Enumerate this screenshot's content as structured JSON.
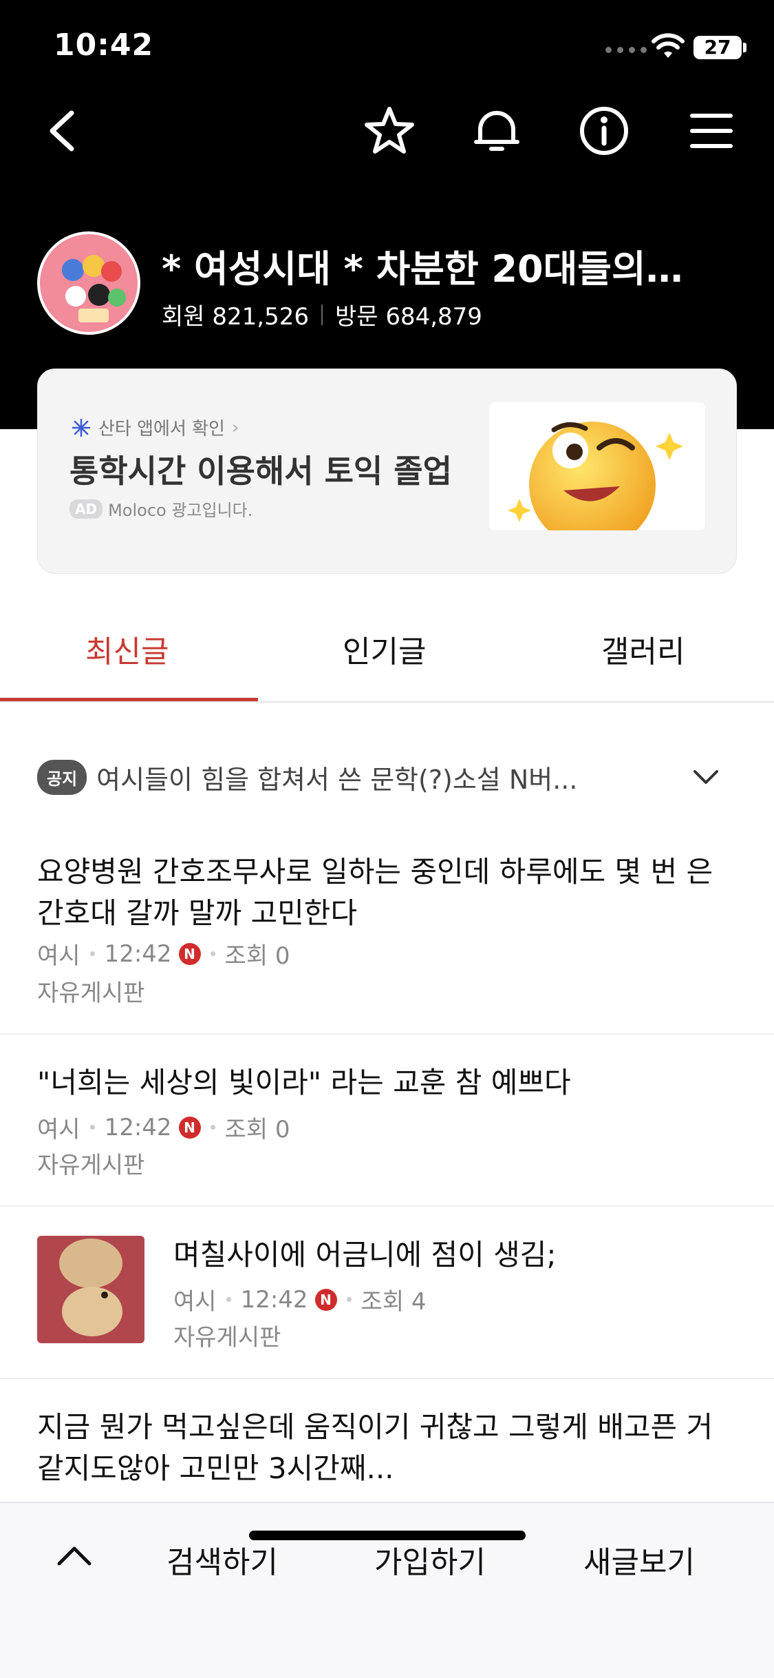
{
  "status": {
    "time": "10:42",
    "battery": "27"
  },
  "cafe": {
    "title": "* 여성시대 *  차분한 20대들의…",
    "members_label": "회원 821,526",
    "visits_label": "방문 684,879"
  },
  "ad": {
    "source": "산타 앱에서 확인",
    "title": "통학시간 이용해서 토익 졸업",
    "badge": "AD",
    "note": "Moloco 광고입니다."
  },
  "tabs": [
    {
      "label": "최신글",
      "active": true
    },
    {
      "label": "인기글",
      "active": false
    },
    {
      "label": "갤러리",
      "active": false
    }
  ],
  "notice": {
    "badge": "공지",
    "text": "여시들이 힘을 합쳐서 쓴 문학(?)소설 N버..."
  },
  "posts": [
    {
      "title": "요양병원 간호조무사로 일하는 중인데 하루에도 몇 번 은 간호대 갈까 말까 고민한다",
      "author": "여시",
      "time": "12:42",
      "new_badge": "N",
      "views": "조회 0",
      "board": "자유게시판"
    },
    {
      "title": "\"너희는 세상의 빛이라\" 라는 교훈 참 예쁘다",
      "author": "여시",
      "time": "12:42",
      "new_badge": "N",
      "views": "조회 0",
      "board": "자유게시판"
    },
    {
      "title": "며칠사이에 어금니에 점이 생김;",
      "author": "여시",
      "time": "12:42",
      "new_badge": "N",
      "views": "조회 4",
      "board": "자유게시판"
    },
    {
      "title": "지금 뭔가 먹고싶은데 움직이기 귀찮고 그렇게 배고픈 거같지도않아 고민만 3시간째..."
    }
  ],
  "bottom_bar": {
    "search": "검색하기",
    "join": "가입하기",
    "new_posts": "새글보기"
  },
  "colors": {
    "accent": "#c73a33",
    "header_bg": "#000000"
  }
}
